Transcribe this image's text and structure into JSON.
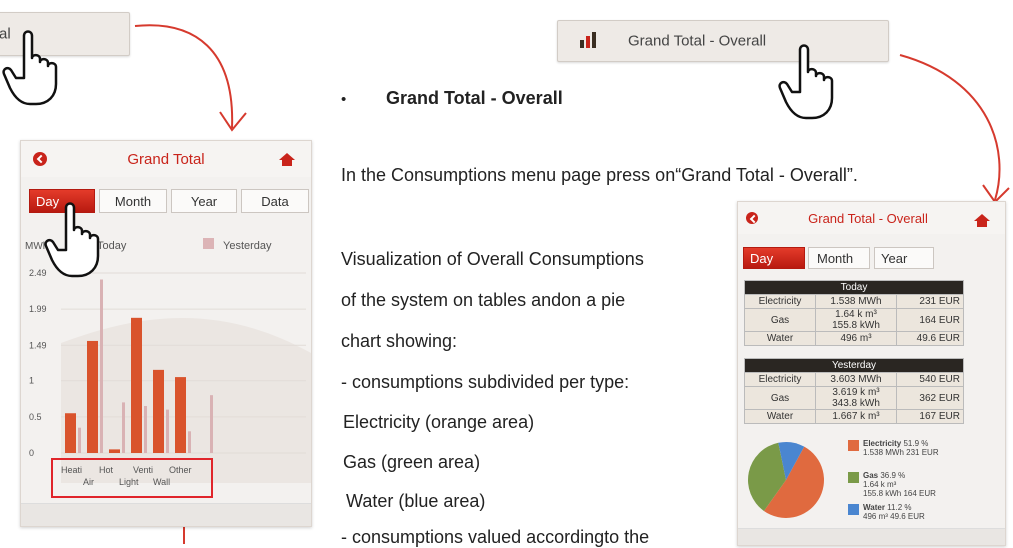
{
  "left_menu_button": {
    "label": "al"
  },
  "right_menu_button": {
    "label": "Grand Total - Overall",
    "icon": "bar-chart-icon"
  },
  "bullet_heading": "Grand Total - Overall",
  "instruction": "In the Consumptions menu page press on“Grand Total - Overall”.",
  "description_lines": [
    "Visualization of Overall Consumptions",
    "of the system on tables andon a pie",
    "chart showing:",
    "- consumptions subdivided per type:",
    " Electricity (orange area)",
    " Gas (green area)",
    " Water (blue area)",
    "- consumptions valued accordingto the"
  ],
  "left_phone": {
    "title": "Grand Total",
    "tabs": [
      "Day",
      "Month",
      "Year",
      "Data"
    ],
    "active_tab": "Day",
    "legend_today": "Today",
    "legend_yesterday": "Yesterday",
    "ylabel": "MWh",
    "y_ticks": [
      "2.49",
      "1.99",
      "1.49",
      "1",
      "0.5",
      "0"
    ],
    "x_labels_top": [
      "Heati",
      "Hot",
      "Venti",
      "Other"
    ],
    "x_labels_bottom": [
      "Air",
      "Light",
      "Wall"
    ]
  },
  "right_phone": {
    "title": "Grand Total - Overall",
    "tabs": [
      "Day",
      "Month",
      "Year"
    ],
    "active_tab": "Day",
    "today": {
      "header": "Today",
      "rows": [
        {
          "type": "Electricity",
          "amount": "1.538 MWh",
          "cost": "231 EUR"
        },
        {
          "type": "Gas",
          "amount": "1.64 k m³",
          "amount2": "155.8 kWh",
          "cost": "164 EUR"
        },
        {
          "type": "Water",
          "amount": "496 m³",
          "cost": "49.6 EUR"
        }
      ]
    },
    "yesterday": {
      "header": "Yesterday",
      "rows": [
        {
          "type": "Electricity",
          "amount": "3.603 MWh",
          "cost": "540 EUR"
        },
        {
          "type": "Gas",
          "amount": "3.619 k m³",
          "amount2": "343.8 kWh",
          "cost": "362 EUR"
        },
        {
          "type": "Water",
          "amount": "1.667 k m³",
          "cost": "167 EUR"
        }
      ]
    },
    "legend": [
      {
        "name": "Electricity",
        "pct": "51.9 %",
        "detail": "1.538 MWh 231 EUR",
        "color": "#e06a3f"
      },
      {
        "name": "Gas",
        "pct": "36.9 %",
        "detail": "1.64 k m³",
        "detail2": "155.8 kWh 164 EUR",
        "color": "#7a9a48"
      },
      {
        "name": "Water",
        "pct": "11.2 %",
        "detail": "496 m³ 49.6 EUR",
        "color": "#4a86d0"
      }
    ]
  },
  "chart_data": {
    "type": "bar",
    "categories": [
      "Heati",
      "Air",
      "Hot",
      "Light",
      "Venti",
      "Wall",
      "Other"
    ],
    "ylabel": "MWh",
    "ylim": [
      0,
      2.49
    ],
    "series": [
      {
        "name": "Today",
        "values": [
          0.55,
          1.55,
          0.05,
          1.87,
          1.15,
          1.05,
          0
        ]
      },
      {
        "name": "Yesterday",
        "values": [
          0.35,
          2.4,
          0.7,
          0.65,
          0.6,
          0.3,
          0.8
        ]
      }
    ]
  }
}
